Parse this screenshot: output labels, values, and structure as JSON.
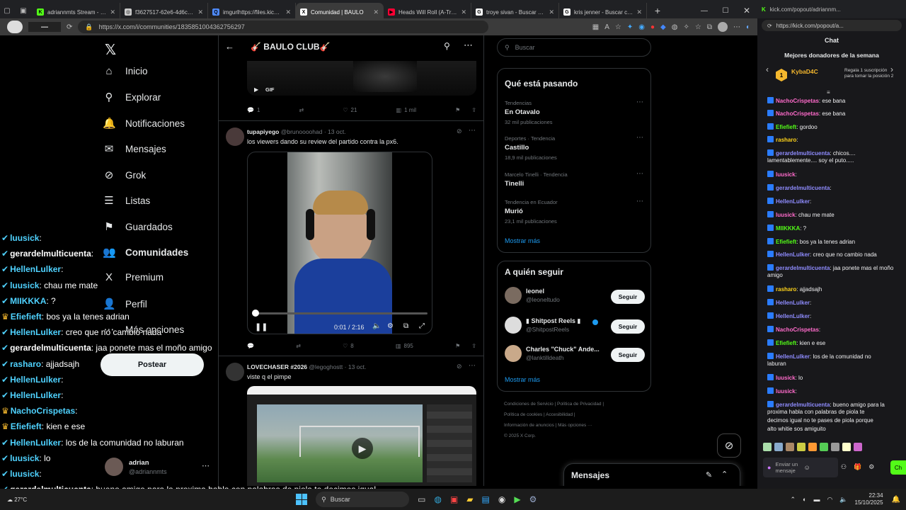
{
  "browser": {
    "tabs": [
      {
        "label": "adriannmts Stream - Watch",
        "fav_color": "#53fc18",
        "fav_text": "K"
      },
      {
        "label": "f3627517-62e6-4d6c-95b",
        "fav_color": "#cccccc",
        "fav_text": "◎"
      },
      {
        "label": "imgurlhttps://files.kick.co",
        "fav_color": "#4f8bff",
        "fav_text": "Q"
      },
      {
        "label": "Comunidad | BAULO",
        "fav_color": "#ffffff",
        "fav_text": "X"
      },
      {
        "label": "Heads Will Roll (A-Trak Re",
        "fav_color": "#ff0033",
        "fav_text": "▶"
      },
      {
        "label": "troye sivan - Buscar con G",
        "fav_color": "#ffffff",
        "fav_text": "G"
      },
      {
        "label": "kris jenner - Buscar con G",
        "fav_color": "#ffffff",
        "fav_text": "G"
      }
    ],
    "url": "https://x.com/i/communities/1835851004362756297"
  },
  "x": {
    "nav": [
      {
        "label": "Inicio",
        "icon": "⌂",
        "name": "nav-home"
      },
      {
        "label": "Explorar",
        "icon": "⚲",
        "name": "nav-explore"
      },
      {
        "label": "Notificaciones",
        "icon": "🔔",
        "name": "nav-notifications"
      },
      {
        "label": "Mensajes",
        "icon": "✉",
        "name": "nav-messages"
      },
      {
        "label": "Grok",
        "icon": "⊘",
        "name": "nav-grok"
      },
      {
        "label": "Listas",
        "icon": "☰",
        "name": "nav-lists"
      },
      {
        "label": "Guardados",
        "icon": "⚑",
        "name": "nav-bookmarks"
      },
      {
        "label": "Comunidades",
        "icon": "👥",
        "name": "nav-communities"
      },
      {
        "label": "Premium",
        "icon": "X",
        "name": "nav-premium"
      },
      {
        "label": "Perfil",
        "icon": "👤",
        "name": "nav-profile"
      },
      {
        "label": "Más opciones",
        "icon": "⋯",
        "name": "nav-more"
      }
    ],
    "post_button": "Postear",
    "user": {
      "name": "adrian",
      "handle": "@adriannmts"
    },
    "community_title": "🎸 BAULO CLUB🎸",
    "gif_label": "GIF",
    "tweet0_actions": {
      "replies": "1",
      "likes": "21",
      "views": "1 mil"
    },
    "tweet1": {
      "name": "tupapiyego",
      "handle": "@brunoooohad",
      "date": "· 13 oct.",
      "text": "los viewers dando su review del partido contra la px6.",
      "time": "0:01 / 2:16",
      "likes": "8",
      "views": "895"
    },
    "tweet2": {
      "name": "LOVECHASER #2026",
      "handle": "@legoghostt",
      "date": "· 13 oct.",
      "text": "viste q el pimpe"
    },
    "search_placeholder": "Buscar",
    "trends_title": "Qué está pasando",
    "trends": [
      {
        "cat": "Tendencias",
        "name": "En Otavalo",
        "count": "32 mil publicaciones"
      },
      {
        "cat": "Deportes · Tendencia",
        "name": "Castillo",
        "count": "18,9 mil publicaciones"
      },
      {
        "cat": "Marcelo Tinelli · Tendencia",
        "name": "Tinelli",
        "count": ""
      },
      {
        "cat": "Tendencia en Ecuador",
        "name": "Murió",
        "count": "23,1 mil publicaciones"
      }
    ],
    "show_more": "Mostrar más",
    "follow_title": "A quién seguir",
    "follow": [
      {
        "name": "leonel",
        "handle": "@leoneltudo",
        "btn": "Seguir"
      },
      {
        "name": "▮ Shitpost Reels ▮",
        "handle": "@ShitpostReels",
        "btn": "Seguir"
      },
      {
        "name": "Charles \"Chuck\" Ande...",
        "handle": "@lanktilldeath",
        "btn": "Seguir"
      }
    ],
    "footer_lines": [
      "Condiciones de Servicio  |  Política de Privacidad  |",
      "Política de cookies  |  Accesibilidad  |",
      "Información de anuncios  |  Más opciones ···",
      "© 2025 X Corp."
    ],
    "messages_label": "Mensajes"
  },
  "overlay_chat": [
    {
      "user": "luusick",
      "text": ":",
      "color": "#4fd2ff"
    },
    {
      "user": "gerardelmulticuenta",
      "text": ":",
      "color": "#ffffff"
    },
    {
      "user": "HellenLulker",
      "text": ":",
      "color": "#4fd2ff"
    },
    {
      "user": "luusick",
      "text": ": chau me mate",
      "color": "#4fd2ff"
    },
    {
      "user": "MIIKKKA",
      "text": ": ?",
      "color": "#4fd2ff"
    },
    {
      "user": "Efiefieft",
      "text": ": bos ya la tenes adrian",
      "color": "#4fd2ff"
    },
    {
      "user": "HellenLulker",
      "text": ": creo que no cambio nada",
      "color": "#4fd2ff"
    },
    {
      "user": "gerardelmulticuenta",
      "text": ": jaa ponete mas el moño amigo",
      "color": "#ffffff"
    },
    {
      "user": "rasharo",
      "text": ": ajjadsajh",
      "color": "#4fd2ff"
    },
    {
      "user": "HellenLulker",
      "text": ":",
      "color": "#4fd2ff"
    },
    {
      "user": "HellenLulker",
      "text": ":",
      "color": "#4fd2ff"
    },
    {
      "user": "NachoCrispetas",
      "text": ":",
      "color": "#4fd2ff"
    },
    {
      "user": "Efiefieft",
      "text": ": kien e ese",
      "color": "#4fd2ff"
    },
    {
      "user": "HellenLulker",
      "text": ": los  de la comunidad no laburan",
      "color": "#4fd2ff"
    },
    {
      "user": "luusick",
      "text": ": lo",
      "color": "#4fd2ff"
    },
    {
      "user": "luusick",
      "text": ":",
      "color": "#4fd2ff"
    },
    {
      "user": "gerardelmulticuenta",
      "text": ": bueno amigo para la proxima habla con palabras de piola te decimos igual",
      "color": "#ffffff"
    },
    {
      "user": "",
      "text": "no te pases de piola porque alto whitie sos amiguito",
      "color": "#ffffff"
    }
  ],
  "kick": {
    "url": "https://kick.com/popout/a...",
    "chat_title": "Chat",
    "top_title": "Mejores donadores de la semana",
    "top_user": "KybaD4C",
    "top_rank": "1",
    "top_hint": "Regala 1 suscripción para tomar la posición 2",
    "messages": [
      {
        "u": "NachoCrispetas",
        "c": "u-o",
        "t": ": ese bana"
      },
      {
        "u": "NachoCrispetas",
        "c": "u-o",
        "t": ": ese bana"
      },
      {
        "u": "Efiefieft",
        "c": "u-g",
        "t": ": gordoo"
      },
      {
        "u": "rasharo",
        "c": "u-y",
        "t": ":"
      },
      {
        "u": "gerardelmulticuenta",
        "c": "u-b",
        "t": ": chicos...."
      },
      {
        "u": "",
        "c": "",
        "t": "lamentablemente.... soy el puto....."
      },
      {
        "u": "luusick",
        "c": "u-o",
        "t": ":"
      },
      {
        "u": "gerardelmulticuenta",
        "c": "u-b",
        "t": ":"
      },
      {
        "u": "HellenLulker",
        "c": "u-b",
        "t": ":"
      },
      {
        "u": "luusick",
        "c": "u-o",
        "t": ": chau me mate"
      },
      {
        "u": "MIIKKKA",
        "c": "u-g",
        "t": ": ?"
      },
      {
        "u": "Efiefieft",
        "c": "u-g",
        "t": ": bos ya la tenes adrian"
      },
      {
        "u": "HellenLulker",
        "c": "u-b",
        "t": ": creo que no cambio nada"
      },
      {
        "u": "gerardelmulticuenta",
        "c": "u-b",
        "t": ": jaa ponete mas el moño"
      },
      {
        "u": "",
        "c": "",
        "t": "amigo"
      },
      {
        "u": "rasharo",
        "c": "u-y",
        "t": ": ajjadsajh"
      },
      {
        "u": "HellenLulker",
        "c": "u-b",
        "t": ":"
      },
      {
        "u": "HellenLulker",
        "c": "u-b",
        "t": ":"
      },
      {
        "u": "NachoCrispetas",
        "c": "u-o",
        "t": ":"
      },
      {
        "u": "Efiefieft",
        "c": "u-g",
        "t": ": kien e ese"
      },
      {
        "u": "HellenLulker",
        "c": "u-b",
        "t": ": los     de la comunidad no"
      },
      {
        "u": "",
        "c": "",
        "t": "laburan"
      },
      {
        "u": "luusick",
        "c": "u-o",
        "t": ": lo"
      },
      {
        "u": "luusick",
        "c": "u-o",
        "t": ":"
      },
      {
        "u": "gerardelmulticuenta",
        "c": "u-b",
        "t": ": bueno amigo para la"
      },
      {
        "u": "",
        "c": "",
        "t": "proxima habla con palabras de piola te"
      },
      {
        "u": "",
        "c": "",
        "t": "decimos igual no te pases de piola porque"
      },
      {
        "u": "",
        "c": "",
        "t": "alto whitie sos amiguito"
      }
    ],
    "input_placeholder": "Enviar un mensaje",
    "send": "Ch"
  },
  "taskbar": {
    "weather": "27°C",
    "search": "Buscar",
    "time": "22:34",
    "date": "15/10/2025"
  }
}
